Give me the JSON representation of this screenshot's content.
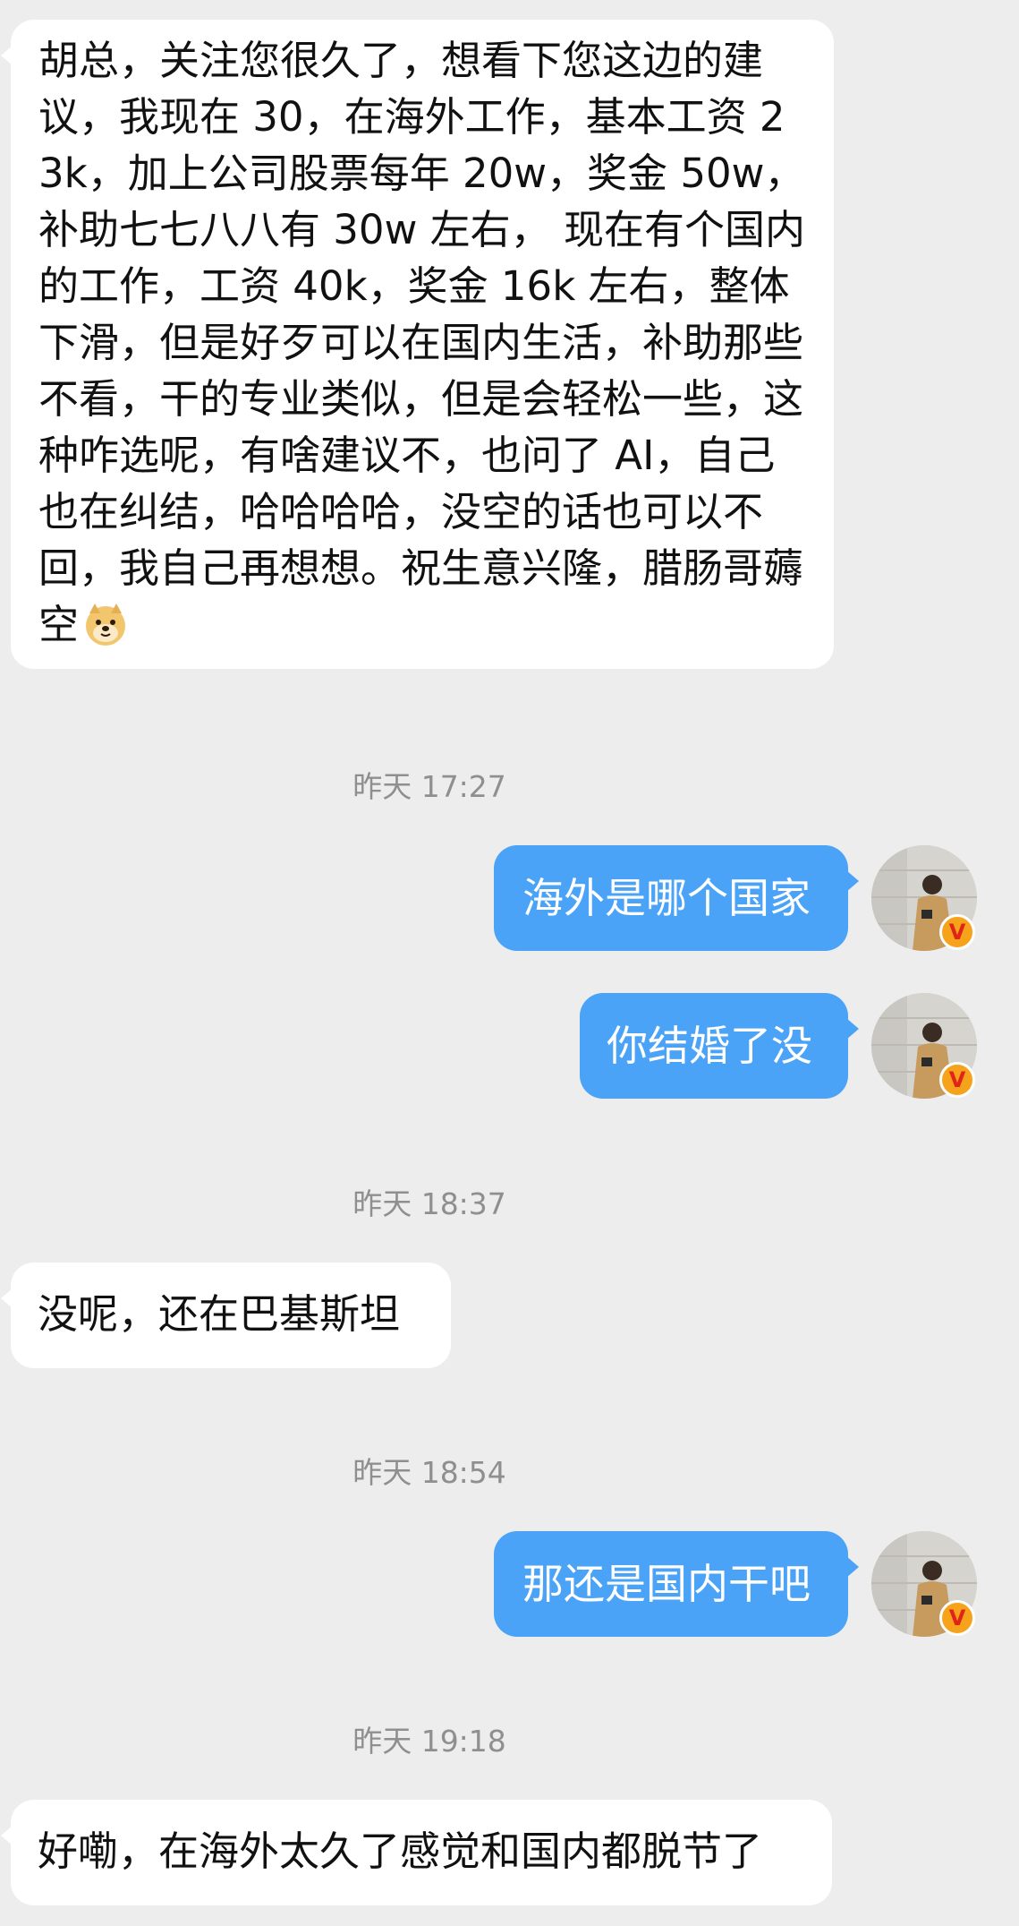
{
  "messages": [
    {
      "text": "胡总，关注您很久了，想看下您这边的建议，我现在 30，在海外工作，基本工资 23k，加上公司股票每年 20w，奖金 50w，补助七七八八有 30w 左右， 现在有个国内的工作，工资 40k，奖金 16k 左右，整体下滑，但是好歹可以在国内生活，补助那些不看，干的专业类似，但是会轻松一些，这种咋选呢，有啥建议不，也问了 AI，自己也在纠结，哈哈哈哈，没空的话也可以不回，我自己再想想。祝生意兴隆，腊肠哥薅空",
      "emoji": "doge-emoji"
    }
  ],
  "timestamps": [
    "昨天 17:27",
    "昨天 18:37",
    "昨天 18:54",
    "昨天 19:18"
  ],
  "outgoing": [
    "海外是哪个国家",
    "你结婚了没",
    "那还是国内干吧"
  ],
  "incoming": [
    "没呢，还在巴基斯坦",
    "好嘞，在海外太久了感觉和国内都脱节了"
  ],
  "badge": "V",
  "colors": {
    "background": "#ededed",
    "incoming_bubble": "#ffffff",
    "outgoing_bubble": "#4aa3f7",
    "timestamp": "#8f8f8f",
    "badge": "#f7a21b"
  }
}
